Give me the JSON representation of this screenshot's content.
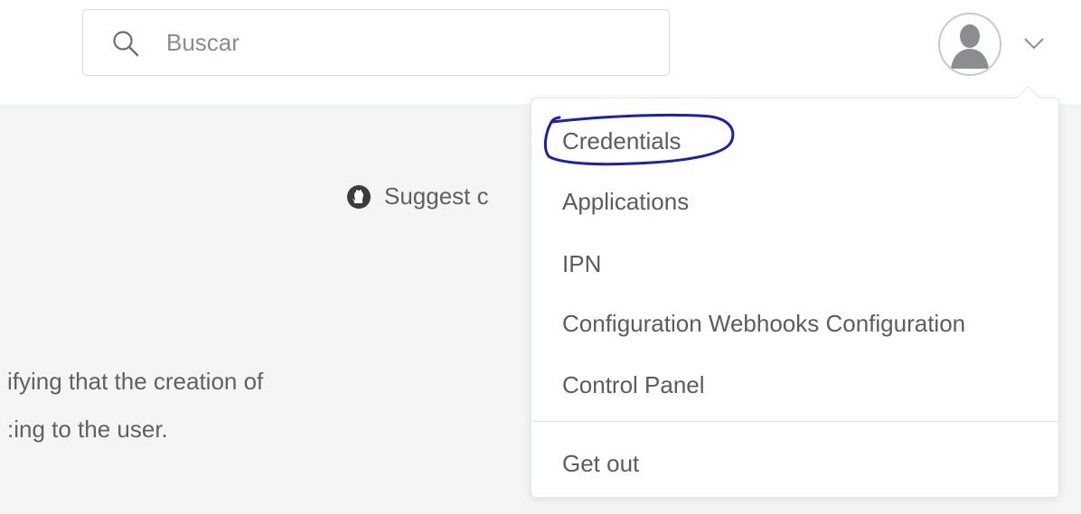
{
  "header": {
    "search": {
      "placeholder": "Buscar",
      "value": "",
      "icon": "search-icon"
    },
    "user_menu": {
      "avatar_icon": "user-avatar-icon",
      "toggle_icon": "chevron-down-icon"
    }
  },
  "content": {
    "suggest_link": {
      "icon": "github-icon",
      "label": "Suggest c"
    },
    "paragraph_lines": [
      "ifying that the creation of",
      ":ing to the user."
    ]
  },
  "dropdown": {
    "items": [
      {
        "label": "Credentials"
      },
      {
        "label": "Applications"
      },
      {
        "label": "IPN"
      },
      {
        "label": "Configuration Webhooks Configuration"
      },
      {
        "label": "Control Panel"
      }
    ],
    "footer_item": {
      "label": "Get out"
    },
    "highlight_color": "#1a1fb8"
  }
}
